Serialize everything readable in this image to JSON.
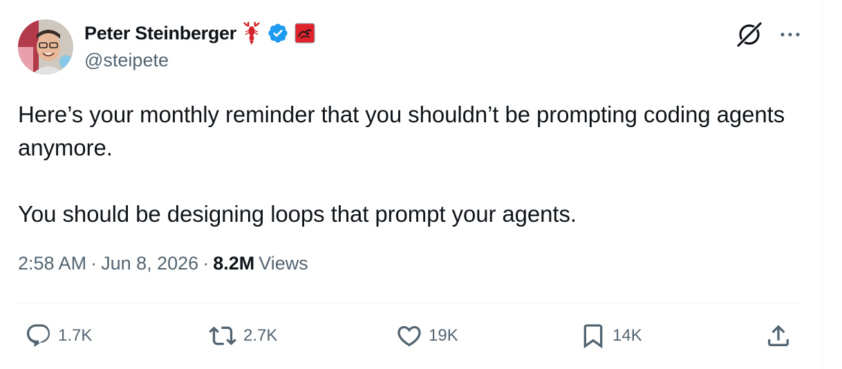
{
  "author": {
    "display_name": "Peter Steinberger",
    "handle": "@steipete",
    "badges": [
      "lobster-emoji-icon",
      "verified-badge-icon",
      "affiliate-badge-icon"
    ]
  },
  "tweet": {
    "text": "Here’s your monthly reminder that you shouldn’t be prompting coding agents anymore.\n\nYou should be designing loops that prompt your agents.",
    "time": "2:58 AM",
    "date": "Jun 8, 2026",
    "separator": "·",
    "views_count": "8.2M",
    "views_label": "Views"
  },
  "actions": {
    "replies": "1.7K",
    "reposts": "2.7K",
    "likes": "19K",
    "bookmarks": "14K"
  },
  "colors": {
    "text": "#0f1419",
    "secondary": "#536471",
    "verified": "#1d9bf0",
    "divider": "#eff3f4"
  },
  "icons": [
    "grok-icon",
    "more-icon",
    "reply-icon",
    "repost-icon",
    "like-icon",
    "bookmark-icon",
    "share-icon"
  ]
}
